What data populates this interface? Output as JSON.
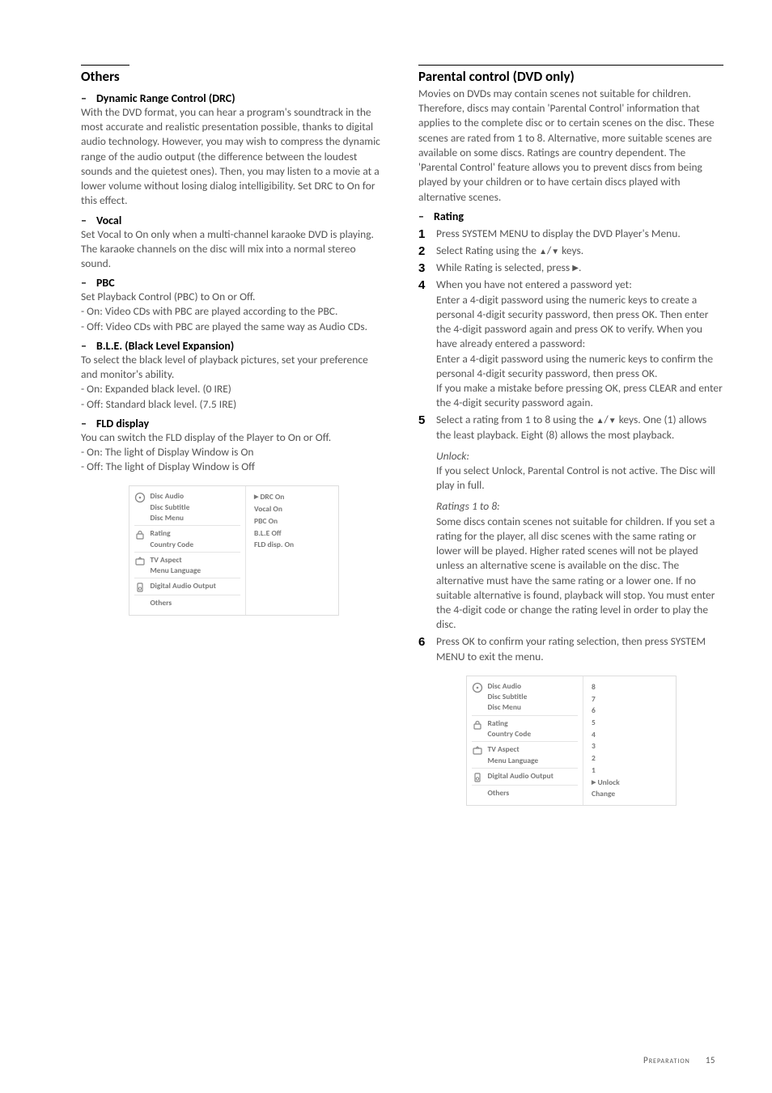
{
  "left": {
    "section_title": "Others",
    "drc": {
      "heading": "Dynamic Range Control (DRC)",
      "body": "With the DVD format, you can hear a program's soundtrack in the most accurate and realistic presentation possible, thanks to digital audio technology. However, you may wish to compress the dynamic range of the audio output (the difference between the loudest sounds and the quietest ones). Then, you may listen to a movie at a lower volume without losing dialog intelligibility. Set DRC to On for this effect."
    },
    "vocal": {
      "heading": "Vocal",
      "body": "Set Vocal to On only when a multi-channel karaoke DVD is playing. The karaoke channels on the disc will mix into a normal stereo sound."
    },
    "pbc": {
      "heading": "PBC",
      "l1": "Set Playback Control (PBC) to On or Off.",
      "l2": "- On: Video CDs with PBC are played according to the PBC.",
      "l3": "- Off: Video CDs with PBC are played the same way as Audio CDs."
    },
    "ble": {
      "heading": "B.L.E. (Black Level Expansion)",
      "l1": "To select the black level of playback pictures, set your preference and monitor's ability.",
      "l2": "- On: Expanded black level. (0 IRE)",
      "l3": "- Off: Standard black level. (7.5 IRE)"
    },
    "fld": {
      "heading": "FLD display",
      "l1": "You can switch the FLD display of the Player to On or Off.",
      "l2": "- On: The light of Display Window is On",
      "l3": "- Off: The light of Display Window is Off"
    },
    "menu": {
      "g1a": "Disc Audio",
      "g1b": "Disc Subtitle",
      "g1c": "Disc Menu",
      "g2a": "Rating",
      "g2b": "Country Code",
      "g3a": "TV Aspect",
      "g3b": "Menu Language",
      "g4a": "Digital Audio Output",
      "g5": "Others",
      "r1": "DRC On",
      "r2": "Vocal On",
      "r3": "PBC On",
      "r4": "B.L.E Off",
      "r5": "FLD disp. On"
    }
  },
  "right": {
    "section_title": "Parental control (DVD only)",
    "intro": "Movies on DVDs may contain scenes not suitable for children. Therefore, discs may contain 'Parental Control' information that applies to the complete disc or to certain scenes on the disc. These scenes are rated from 1 to 8. Alternative, more suitable scenes are available on some discs. Ratings are country dependent. The 'Parental Control' feature allows you to prevent discs from being played by your children or to have certain discs played with alternative scenes.",
    "rating_heading": "Rating",
    "steps": {
      "s1": "Press SYSTEM MENU to display the DVD Player's Menu.",
      "s2_a": "Select Rating using the ",
      "s2_b": " keys.",
      "s3_a": "While Rating is selected, press ",
      "s3_b": ".",
      "s4": "When you have not entered a password yet:\nEnter a 4-digit password using the numeric keys to create a personal 4-digit security password, then press OK. Then enter the 4-digit password again and press OK to verify. When you have already entered a password:\nEnter a 4-digit password using the numeric keys to confirm the personal 4-digit security password, then press OK.\nIf you make a mistake before pressing OK, press CLEAR and enter the 4-digit security password again.",
      "s5_a": "Select a rating from 1 to 8 using the ",
      "s5_b": " keys. One (1) allows the least playback. Eight (8) allows the most playback.",
      "unlock_h": "Unlock:",
      "unlock_b": "If you select Unlock, Parental Control is not active. The Disc will play in full.",
      "ratings_h": "Ratings 1 to 8:",
      "ratings_b": "Some discs contain scenes not suitable for children. If you set a rating for the player, all disc scenes with the same rating or lower will be played. Higher rated scenes will not be played unless an alternative scene is available on the disc. The alternative must have the same rating or a lower one. If no suitable alternative is found, playback will stop. You must enter the 4-digit code or change the rating level in order to play the disc.",
      "s6": "Press OK to confirm your rating selection, then press SYSTEM MENU to exit the menu."
    },
    "menu": {
      "g1a": "Disc Audio",
      "g1b": "Disc Subtitle",
      "g1c": "Disc Menu",
      "g2a": "Rating",
      "g2b": "Country Code",
      "g3a": "TV Aspect",
      "g3b": "Menu Language",
      "g4a": "Digital Audio Output",
      "g5": "Others",
      "r8": "8",
      "r7": "7",
      "r6": "6",
      "r5": "5",
      "r4": "4",
      "r3": "3",
      "r2": "2",
      "r1": "1",
      "ru": "Unlock",
      "rc": "Change"
    }
  },
  "footer": {
    "section": "Preparation",
    "page": "15"
  }
}
